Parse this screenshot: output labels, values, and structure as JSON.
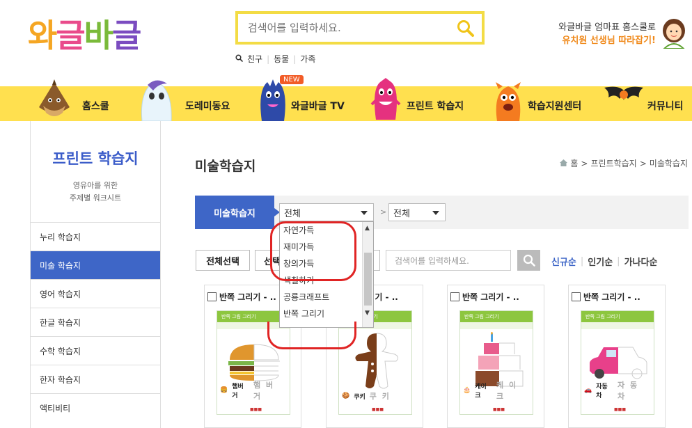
{
  "header": {
    "logo_chars": [
      {
        "ch": "와",
        "color": "#f5a623"
      },
      {
        "ch": "글",
        "color": "#e94b8b"
      },
      {
        "ch": "바",
        "color": "#7aba3a"
      },
      {
        "ch": "글",
        "color": "#7b4cc0"
      }
    ],
    "search_placeholder": "검색어를 입력하세요.",
    "tags": [
      "친구",
      "동물",
      "가족"
    ],
    "promo_line1": "와글바글 엄마표 홈스쿨로",
    "promo_line2": "유치원 선생님 따라잡기!"
  },
  "nav": [
    {
      "label": "홈스쿨",
      "icon": "chestnut-character-icon"
    },
    {
      "label": "도레미동요",
      "icon": "ghost-character-icon"
    },
    {
      "label": "와글바글 TV",
      "icon": "blue-monster-icon",
      "badge": "NEW"
    },
    {
      "label": "프린트 학습지",
      "icon": "pink-monster-icon"
    },
    {
      "label": "학습지원센터",
      "icon": "orange-monster-icon"
    },
    {
      "label": "커뮤니티",
      "icon": "bat-icon"
    }
  ],
  "sidebar": {
    "title": "프린트 학습지",
    "subtitle1": "영유아를 위한",
    "subtitle2": "주제별 워크시트",
    "items": [
      {
        "label": "누리 학습지",
        "active": false
      },
      {
        "label": "미술 학습지",
        "active": true
      },
      {
        "label": "영어 학습지",
        "active": false
      },
      {
        "label": "한글 학습지",
        "active": false
      },
      {
        "label": "수학 학습지",
        "active": false
      },
      {
        "label": "한자 학습지",
        "active": false
      },
      {
        "label": "액티비티",
        "active": false
      }
    ]
  },
  "main": {
    "title": "미술학습지",
    "breadcrumb": [
      "홈",
      "프린트학습지",
      "미술학습지"
    ],
    "filter_label": "미술학습지",
    "select1_value": "전체",
    "select2_value": "전체",
    "dropdown_options": [
      "자연가득",
      "재미가득",
      "창의가득",
      "색칠하기",
      "공룡크래프트",
      "반쪽 그리기"
    ],
    "select_all_button": "전체선택",
    "select_button": "선택",
    "search_placeholder": "검색어를 입력하세요.",
    "sort": [
      "신규순",
      "인기순",
      "가나다순"
    ]
  },
  "cards": [
    {
      "title": "반쪽 그리기 - ..",
      "sheet_header": "반쪽 그림 그리기",
      "caption_key": "햄버거",
      "caption_trace": "햄 버 거",
      "object": "hamburger"
    },
    {
      "title": "반쪽 그리기 - ..",
      "sheet_header": "반쪽 그림 그리기",
      "caption_key": "쿠키",
      "caption_trace": "쿠 키",
      "object": "gingerbread"
    },
    {
      "title": "반쪽 그리기 - ..",
      "sheet_header": "반쪽 그림 그리기",
      "caption_key": "케이크",
      "caption_trace": "케 이 크",
      "object": "cake"
    },
    {
      "title": "반쪽 그리기 - ..",
      "sheet_header": "반쪽 그림 그리기",
      "caption_key": "자동차",
      "caption_trace": "자 동 차",
      "object": "car"
    }
  ],
  "colors": {
    "brand_blue": "#3e66c7",
    "nav_yellow": "#ffe04f",
    "search_border": "#f3dc45",
    "highlight_red": "#e02424"
  }
}
